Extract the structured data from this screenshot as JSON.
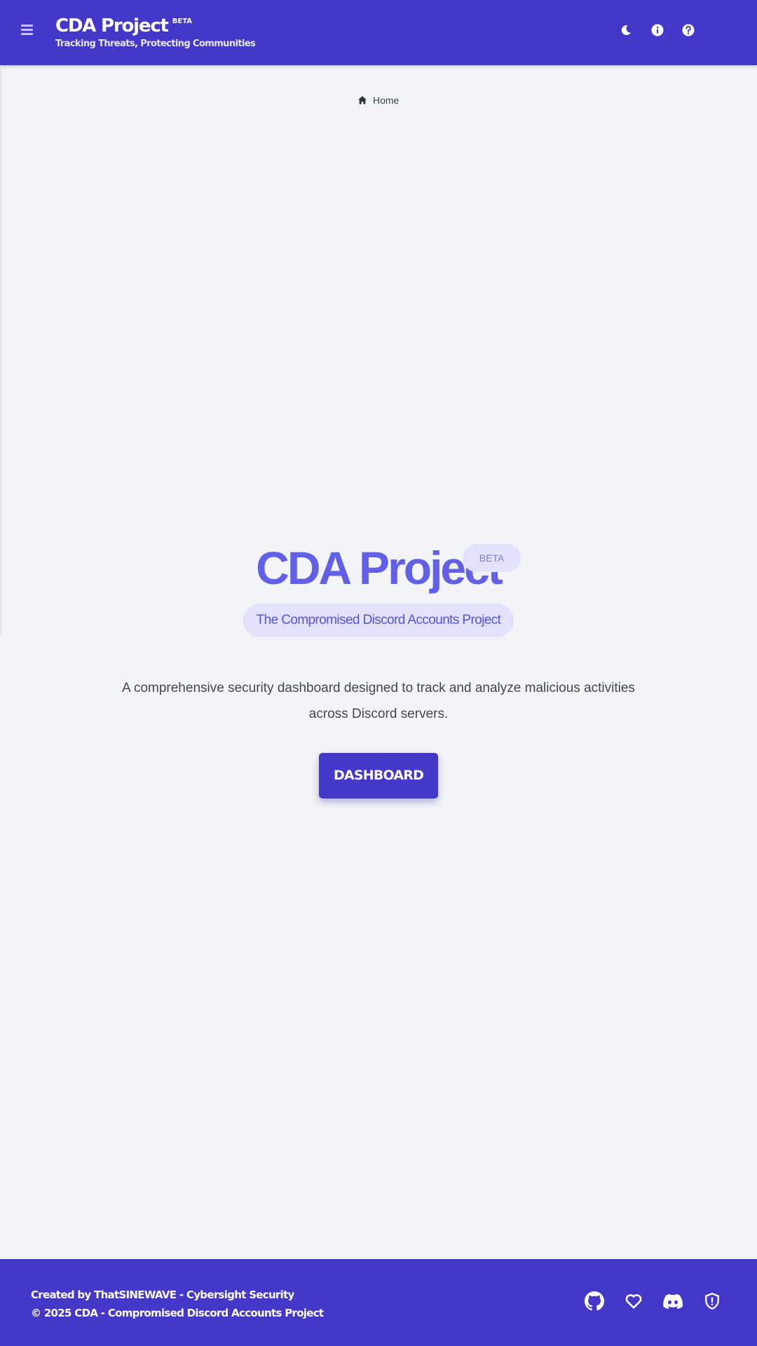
{
  "header": {
    "title": "CDA Project",
    "beta_badge": "BETA",
    "tagline": "Tracking Threats, Protecting Communities",
    "icons": [
      "menu-icon",
      "moon-icon",
      "info-icon",
      "help-icon"
    ]
  },
  "breadcrumb": {
    "home_label": "Home"
  },
  "hero": {
    "title": "CDA Project",
    "beta_badge": "BETA",
    "subtitle": "The Compromised Discord Accounts Project",
    "description_line1": "A comprehensive security dashboard designed to track and analyze malicious activities",
    "description_line2": "across Discord servers.",
    "button_label": "DASHBOARD"
  },
  "footer": {
    "credit": "Created by ThatSINEWAVE - Cybersight Security",
    "copyright": "© 2025 CDA - Compromised Discord Accounts Project",
    "icons": [
      "github-icon",
      "heart-icon",
      "discord-icon",
      "shield-icon"
    ]
  },
  "colors": {
    "primary": "#4338ca",
    "hero_title": "#6360e8",
    "pill_bg": "#e2e3fb",
    "page_bg": "#f2f4f7"
  }
}
